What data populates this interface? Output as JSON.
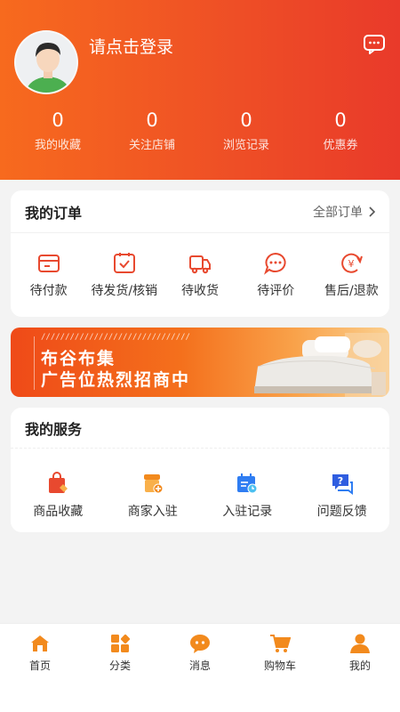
{
  "header": {
    "login_text": "请点击登录",
    "stats": [
      {
        "value": "0",
        "label": "我的收藏"
      },
      {
        "value": "0",
        "label": "关注店铺"
      },
      {
        "value": "0",
        "label": "浏览记录"
      },
      {
        "value": "0",
        "label": "优惠券"
      }
    ]
  },
  "orders": {
    "title": "我的订单",
    "all_label": "全部订单",
    "items": [
      {
        "label": "待付款",
        "icon": "wallet-icon"
      },
      {
        "label": "待发货/核销",
        "icon": "box-check-icon"
      },
      {
        "label": "待收货",
        "icon": "truck-icon"
      },
      {
        "label": "待评价",
        "icon": "comment-icon"
      },
      {
        "label": "售后/退款",
        "icon": "refund-icon"
      }
    ]
  },
  "banner": {
    "line1": "布谷布集",
    "line2": "广告位热烈招商中",
    "dots": "///////////////////////////////"
  },
  "services": {
    "title": "我的服务",
    "items": [
      {
        "label": "商品收藏",
        "icon": "bag-icon"
      },
      {
        "label": "商家入驻",
        "icon": "store-add-icon"
      },
      {
        "label": "入驻记录",
        "icon": "calendar-icon"
      },
      {
        "label": "问题反馈",
        "icon": "question-chat-icon"
      }
    ]
  },
  "tabbar": {
    "items": [
      {
        "label": "首页",
        "icon": "home-icon"
      },
      {
        "label": "分类",
        "icon": "category-icon"
      },
      {
        "label": "消息",
        "icon": "message-icon"
      },
      {
        "label": "购物车",
        "icon": "cart-icon"
      },
      {
        "label": "我的",
        "icon": "user-icon"
      }
    ]
  },
  "colors": {
    "accent": "#f05a22",
    "header_start": "#f76a1e",
    "header_end": "#e93a2a",
    "icon_red": "#e8492f",
    "icon_orange": "#f28a1d",
    "icon_blue": "#2f7df2"
  }
}
